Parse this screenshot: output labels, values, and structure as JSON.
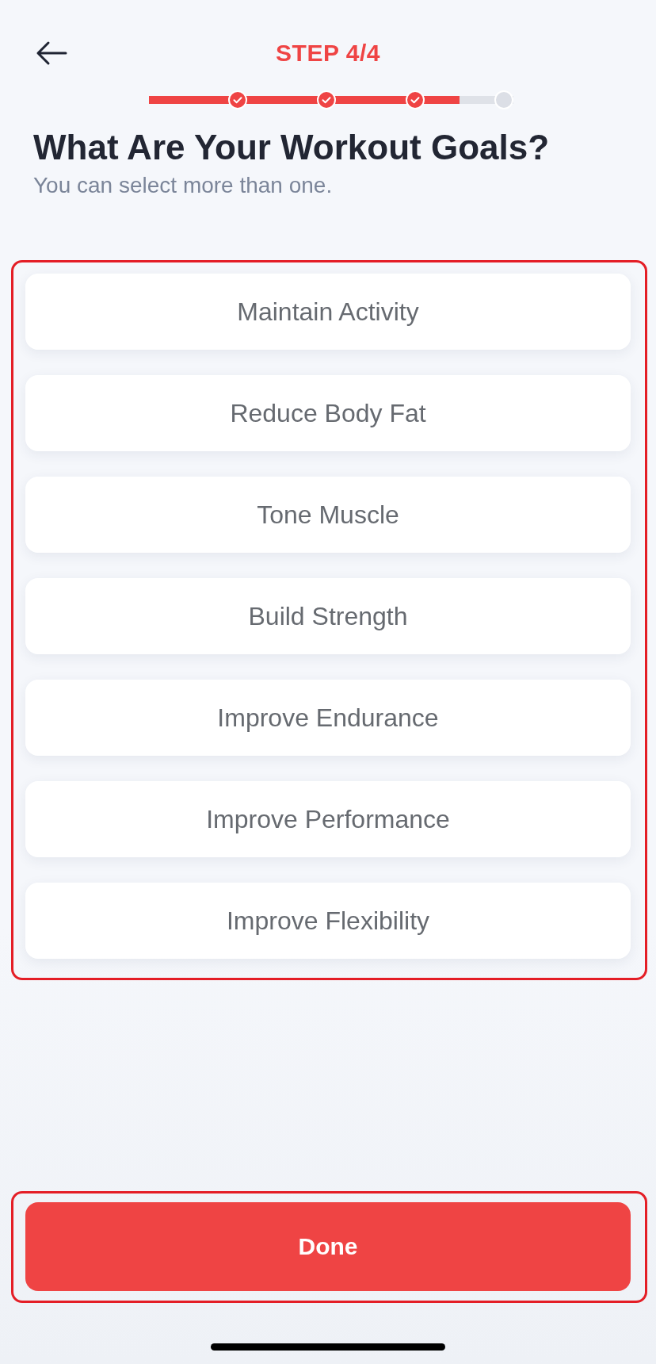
{
  "header": {
    "title": "STEP 4/4"
  },
  "progress": {
    "level": 0.875,
    "steps": [
      {
        "completed": true
      },
      {
        "completed": true
      },
      {
        "completed": true
      },
      {
        "completed": false
      }
    ]
  },
  "heading": "What Are Your Workout Goals?",
  "subtitle": "You can select more than one.",
  "goals": {
    "highlighted": true,
    "options": [
      {
        "label": "Maintain Activity",
        "selected": false
      },
      {
        "label": "Reduce Body Fat",
        "selected": false
      },
      {
        "label": "Tone Muscle",
        "selected": false
      },
      {
        "label": "Build Strength",
        "selected": false
      },
      {
        "label": "Improve Endurance",
        "selected": false
      },
      {
        "label": "Improve Performance",
        "selected": false
      },
      {
        "label": "Improve Flexibility",
        "selected": false
      }
    ]
  },
  "done_button": {
    "label": "Done",
    "highlighted": true
  }
}
